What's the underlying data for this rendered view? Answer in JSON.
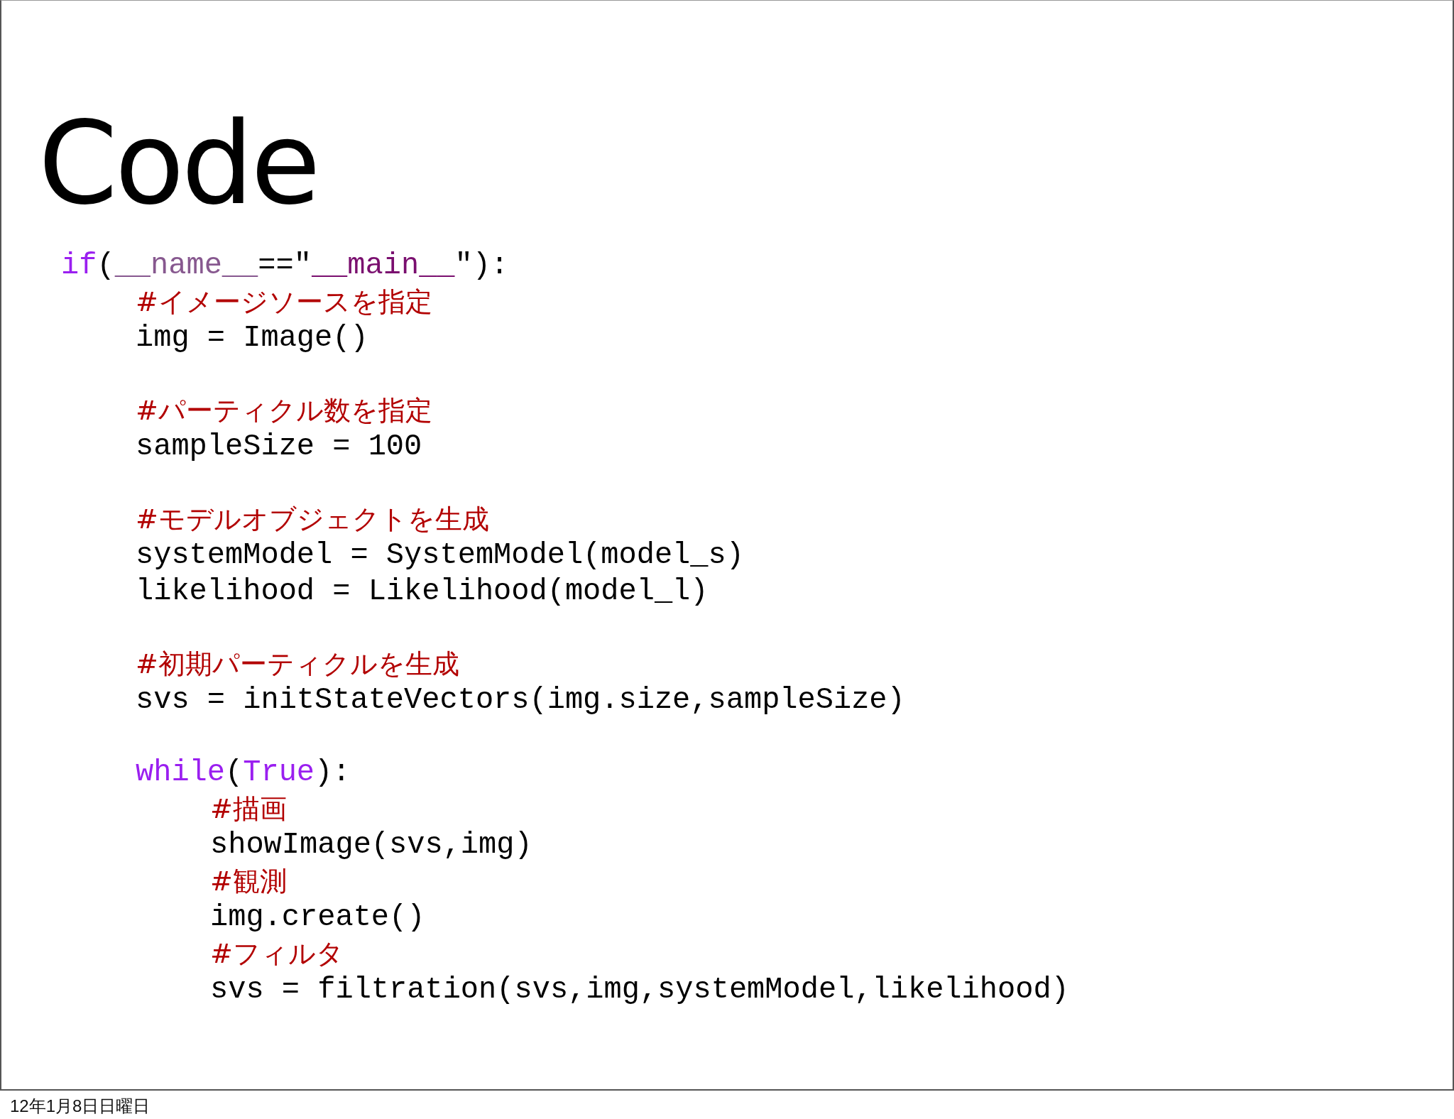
{
  "slide": {
    "title": "Code",
    "code": [
      {
        "tokens": [
          {
            "kind": "keyword",
            "text": "if"
          },
          {
            "kind": "plain",
            "text": "("
          },
          {
            "kind": "dunder",
            "text": "__name__"
          },
          {
            "kind": "plain",
            "text": "==\""
          },
          {
            "kind": "string",
            "text": "__main__"
          },
          {
            "kind": "plain",
            "text": "\"):"
          }
        ],
        "children": [
          [
            {
              "tokens": [
                {
                  "kind": "comment",
                  "text": "#イメージソースを指定"
                }
              ]
            },
            {
              "tokens": [
                {
                  "kind": "plain",
                  "text": "img = Image()"
                }
              ]
            }
          ],
          [
            {
              "tokens": [
                {
                  "kind": "comment",
                  "text": "#パーティクル数を指定"
                }
              ]
            },
            {
              "tokens": [
                {
                  "kind": "plain",
                  "text": "sampleSize = 100"
                }
              ]
            }
          ],
          [
            {
              "tokens": [
                {
                  "kind": "comment",
                  "text": "#モデルオブジェクトを生成"
                }
              ]
            },
            {
              "tokens": [
                {
                  "kind": "plain",
                  "text": "systemModel = SystemModel(model_s)"
                }
              ]
            },
            {
              "tokens": [
                {
                  "kind": "plain",
                  "text": "likelihood = Likelihood(model_l)"
                }
              ]
            }
          ],
          [
            {
              "tokens": [
                {
                  "kind": "comment",
                  "text": "#初期パーティクルを生成"
                }
              ]
            },
            {
              "tokens": [
                {
                  "kind": "plain",
                  "text": "svs = initStateVectors(img.size,sampleSize)"
                }
              ]
            }
          ],
          [
            {
              "tokens": [
                {
                  "kind": "keyword",
                  "text": "while"
                },
                {
                  "kind": "plain",
                  "text": "("
                },
                {
                  "kind": "keyword",
                  "text": "True"
                },
                {
                  "kind": "plain",
                  "text": "):"
                }
              ],
              "children": [
                [
                  {
                    "tokens": [
                      {
                        "kind": "comment",
                        "text": "#描画"
                      }
                    ]
                  },
                  {
                    "tokens": [
                      {
                        "kind": "plain",
                        "text": "showImage(svs,img)"
                      }
                    ]
                  },
                  {
                    "tokens": [
                      {
                        "kind": "comment",
                        "text": "#観測"
                      }
                    ]
                  },
                  {
                    "tokens": [
                      {
                        "kind": "plain",
                        "text": "img.create()"
                      }
                    ]
                  },
                  {
                    "tokens": [
                      {
                        "kind": "comment",
                        "text": "#フィルタ"
                      }
                    ]
                  },
                  {
                    "tokens": [
                      {
                        "kind": "plain",
                        "text": "svs = filtration(svs,img,systemModel,likelihood)"
                      }
                    ]
                  }
                ]
              ]
            }
          ]
        ]
      }
    ]
  },
  "footer": {
    "date": "12年1月8日日曜日"
  }
}
